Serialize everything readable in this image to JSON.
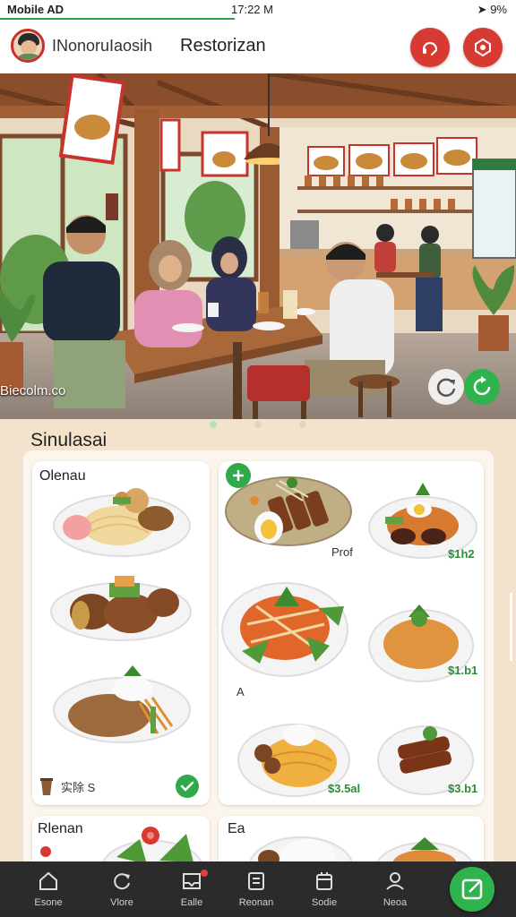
{
  "status_bar": {
    "carrier": "Mobile AD",
    "time": "17:22 M",
    "battery": "9%"
  },
  "header": {
    "brand": "INonoruIaosih",
    "title": "Restorizan"
  },
  "hero": {
    "caption": "Biecolm.co"
  },
  "section": {
    "title": "Sinulasai"
  },
  "cards": {
    "left_top": {
      "title": "Olenau",
      "tag_label": "实除 S"
    },
    "right_top": {
      "label_prof": "Prof",
      "price_1": "$1h2",
      "price_2": "$1.b1",
      "label_a": "A",
      "price_3": "$3.5al",
      "price_4": "$3.b1"
    },
    "left_bottom": {
      "title": "Rlenan"
    },
    "right_bottom": {
      "title": "Ea"
    }
  },
  "nav": {
    "items": [
      {
        "label": "Esone",
        "icon": "home-icon"
      },
      {
        "label": "Vlore",
        "icon": "refresh-icon"
      },
      {
        "label": "Ealle",
        "icon": "inbox-icon"
      },
      {
        "label": "Reonan",
        "icon": "document-icon"
      },
      {
        "label": "Sodie",
        "icon": "calendar-icon"
      },
      {
        "label": "Neoa",
        "icon": "user-icon"
      }
    ]
  },
  "colors": {
    "accent_red": "#d63a32",
    "accent_green": "#2fb34d",
    "nav_bg": "#2b2b2b",
    "price_green": "#2e8b3a"
  }
}
